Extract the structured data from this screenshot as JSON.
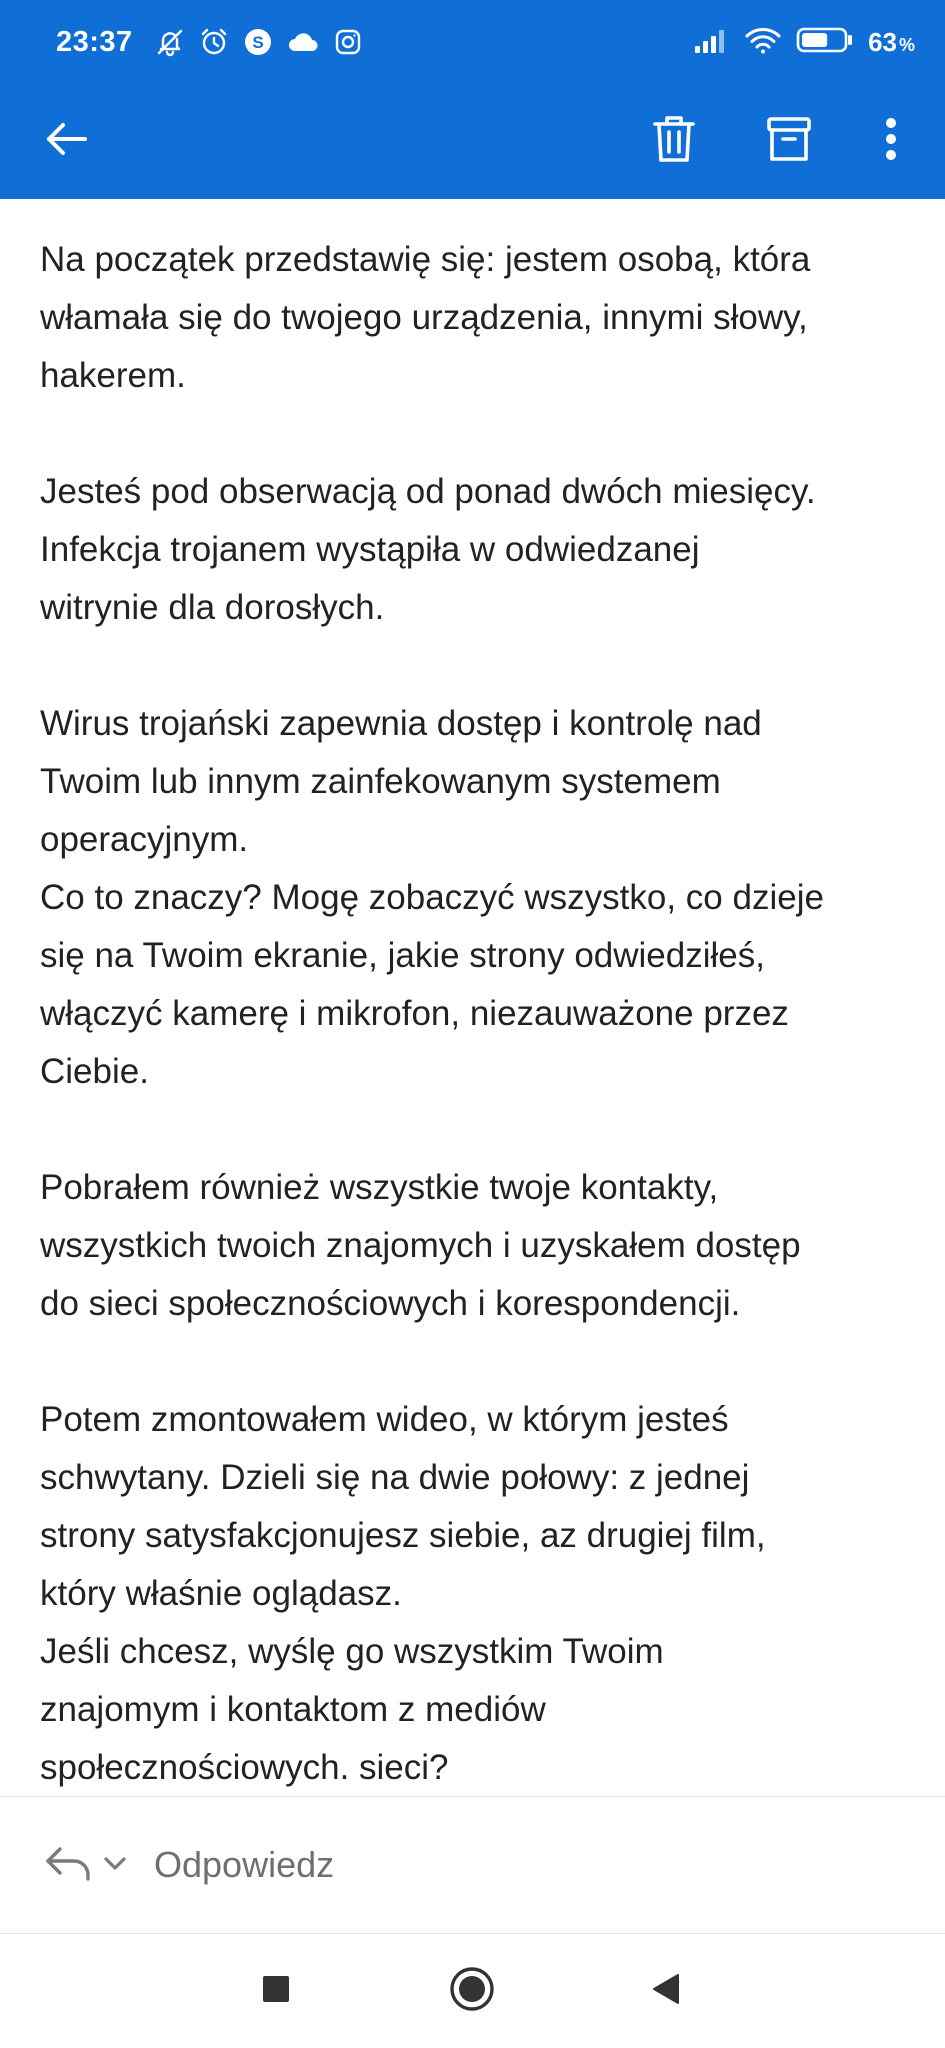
{
  "status_bar": {
    "time": "23:37",
    "icons": [
      "notifications-off-icon",
      "alarm-icon",
      "skype-icon",
      "cloud-icon",
      "instagram-icon"
    ],
    "signal_icon": "signal-icon",
    "wifi_icon": "wifi-icon",
    "battery_level": 0.63,
    "battery_value": "63",
    "battery_unit": "%"
  },
  "toolbar": {
    "back_icon": "back-arrow-icon",
    "delete_icon": "trash-icon",
    "archive_icon": "archive-icon",
    "more_icon": "more-vertical-icon"
  },
  "message": {
    "paragraphs": [
      "Na początek przedstawię się: jestem osobą, która\nwłamała się do twojego urządzenia, innymi słowy,\nhakerem.",
      "Jesteś pod obserwacją od ponad dwóch miesięcy.\nInfekcja trojanem wystąpiła w odwiedzanej\nwitrynie dla dorosłych.",
      "Wirus trojański zapewnia dostęp i kontrolę nad\nTwoim lub innym zainfekowanym systemem\noperacyjnym.\nCo to znaczy? Mogę zobaczyć wszystko, co dzieje\nsię na Twoim ekranie, jakie strony odwiedziłeś,\nwłączyć kamerę i mikrofon, niezauważone przez\nCiebie.",
      "Pobrałem również wszystkie twoje kontakty,\nwszystkich twoich znajomych i uzyskałem dostęp\ndo sieci społecznościowych i korespondencji.",
      "Potem zmontowałem wideo, w którym jesteś\nschwytany. Dzieli się na dwie połowy: z jednej\nstrony satysfakcjonujesz siebie, az drugiej film,\nktóry właśnie oglądasz.\nJeśli chcesz, wyślę go wszystkim Twoim\nznajomym i kontaktom z mediów\nspołecznościowych. sieci?"
    ]
  },
  "reply_bar": {
    "reply_icon": "reply-icon",
    "dropdown_icon": "chevron-down-icon",
    "label": "Odpowiedz"
  },
  "nav_bar": {
    "recents_icon": "recents-square-icon",
    "home_icon": "home-circle-icon",
    "back_icon": "back-triangle-icon"
  },
  "colors": {
    "header": "#0f6fd6",
    "text": "#222222",
    "muted": "#6f6f6f",
    "nav_icons": "#333333"
  }
}
